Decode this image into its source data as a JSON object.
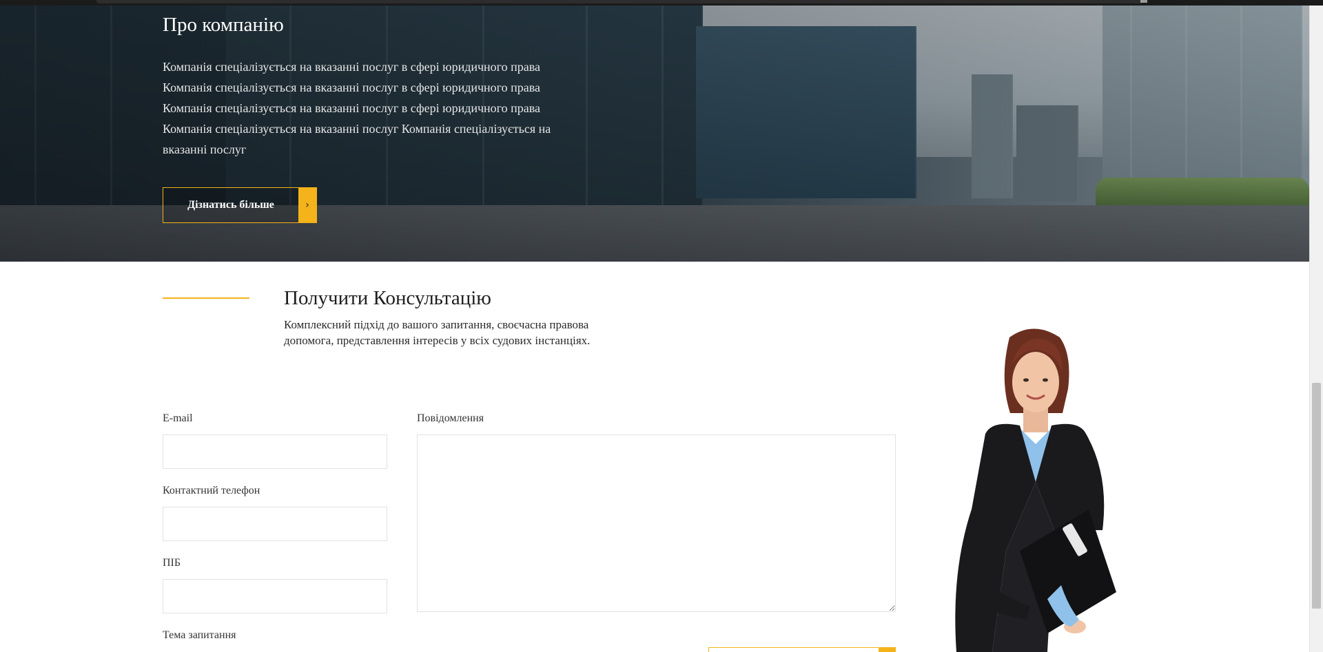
{
  "hero": {
    "title": "Про компанію",
    "paragraph_lines": [
      "Компанія спеціалізується на вказанні послуг в сфері юридичного права",
      "Компанія спеціалізується на вказанні послуг в сфері юридичного права",
      "Компанія спеціалізується на вказанні послуг в сфері юридичного права",
      "Компанія спеціалізується на вказанні послуг Компанія спеціалізується на",
      "вказанні послуг"
    ],
    "button_label": "Дізнатись більше",
    "button_icon": "chevron-right-icon"
  },
  "consultation": {
    "title": "Получити Консультацію",
    "subtitle": "Комплексний підхід до вашого запитання, своєчасна правова допомога, представлення інтересів у всіх судових інстанціях.",
    "fields": {
      "email_label": "E-mail",
      "phone_label": "Контактний телефон",
      "name_label": "ПІБ",
      "topic_label": "Тема запитання",
      "message_label": "Повідомлення"
    }
  },
  "colors": {
    "accent": "#f4b31a",
    "text": "#222222"
  }
}
